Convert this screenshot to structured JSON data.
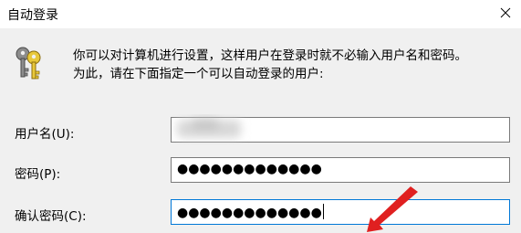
{
  "window": {
    "title": "自动登录",
    "close_glyph": "✕"
  },
  "intro": {
    "line1": "你可以对计算机进行设置，这样用户在登录时就不必输入用户名和密码。",
    "line2": "为此，请在下面指定一个可以自动登录的用户:"
  },
  "form": {
    "username_label": "用户名(U):",
    "username_value": "",
    "password_label": "密码(P):",
    "password_value": "●●●●●●●●●●●●●",
    "confirm_label": "确认密码(C):",
    "confirm_value": "●●●●●●●●●●●●●"
  },
  "icons": {
    "header_icon": "keys-icon",
    "close_icon": "close-icon",
    "annotation": "red-arrow-icon"
  },
  "colors": {
    "focus_border": "#0078d7",
    "annotation_red": "#e02020"
  }
}
